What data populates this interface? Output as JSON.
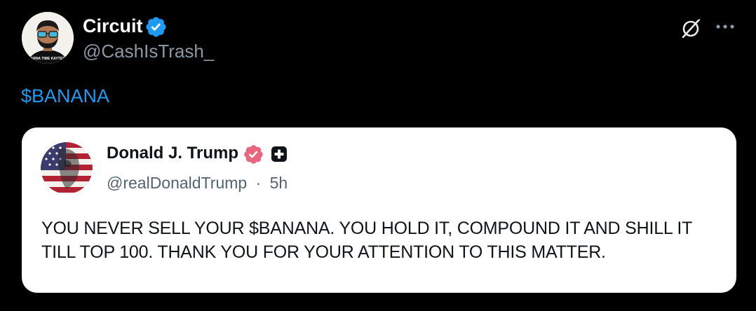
{
  "post": {
    "author": {
      "name": "Circuit",
      "handle": "@CashIsTrash_",
      "avatar_caption": "ARNA TIME KAYTES"
    },
    "text": "$BANANA",
    "accent_color": "#1d9bf0",
    "icons": {
      "verified": "verified-badge-icon",
      "grok": "grok-icon",
      "more": "more-options-icon"
    }
  },
  "quote": {
    "author": {
      "name": "Donald J. Trump",
      "handle": "@realDonaldTrump",
      "separator": "·",
      "time": "5h"
    },
    "text": "YOU NEVER SELL YOUR $BANANA. YOU HOLD IT, COMPOUND IT AND SHILL IT TILL TOP 100. THANK YOU FOR YOUR ATTENTION TO THIS MATTER.",
    "badge_color": "#e0245e",
    "icons": {
      "verified": "verified-badge-icon",
      "plus": "plus-square-icon"
    }
  }
}
